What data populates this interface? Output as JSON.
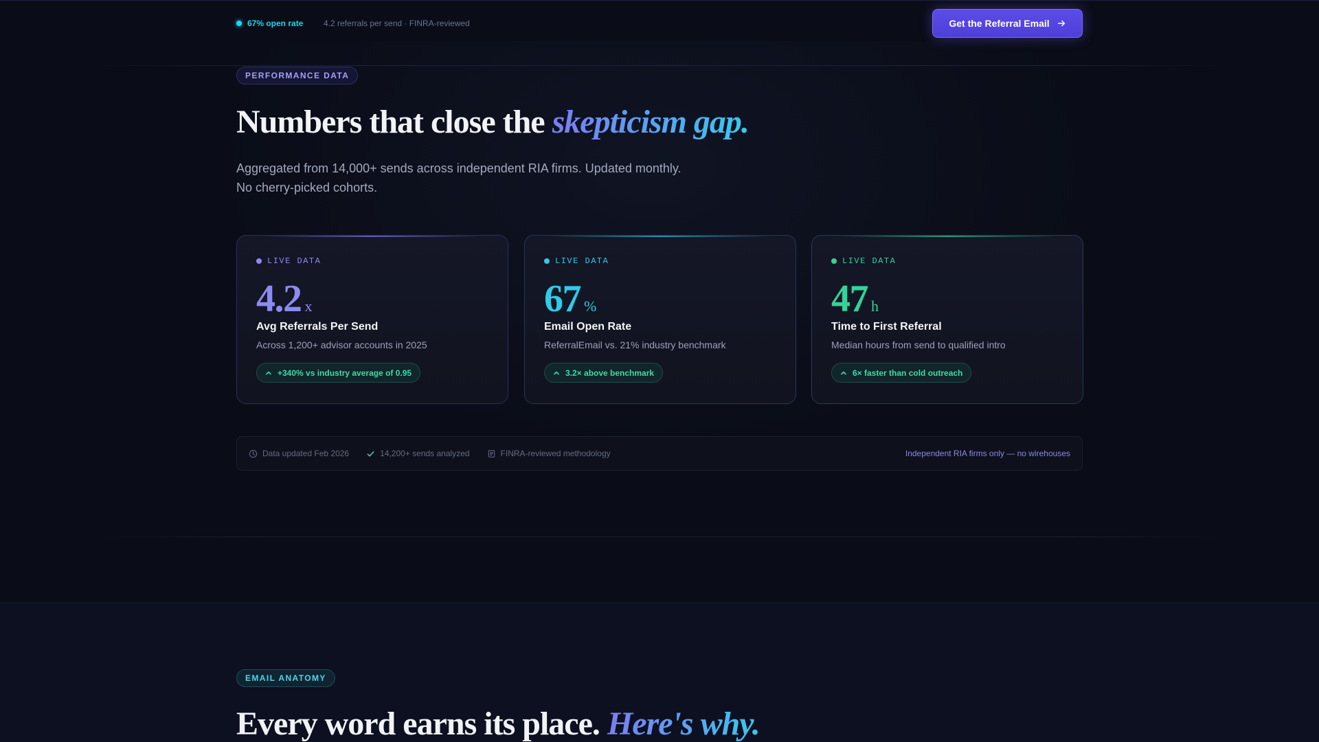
{
  "topbar": {
    "open_rate": "67% open rate",
    "meta": "4.2 referrals per send · FINRA-reviewed",
    "cta_label": "Get the Referral Email"
  },
  "section1": {
    "eyebrow": "PERFORMANCE DATA",
    "headline_plain": "Numbers that close the ",
    "headline_em": "skepticism gap.",
    "subtitle_line1": "Aggregated from 14,000+ sends across independent RIA firms. Updated monthly.",
    "subtitle_line2": "No cherry-picked cohorts."
  },
  "cards": [
    {
      "live": "LIVE DATA",
      "value": "4.2",
      "unit": "x",
      "title": "Avg Referrals Per Send",
      "desc": "Across 1,200+ advisor accounts in 2025",
      "badge": "+340% vs industry average of 0.95",
      "accent": "#8b8bf2"
    },
    {
      "live": "LIVE DATA",
      "value": "67",
      "unit": "%",
      "title": "Email Open Rate",
      "desc": "ReferralEmail vs. 21% industry benchmark",
      "badge": "3.2× above benchmark",
      "accent": "#2fcbe8"
    },
    {
      "live": "LIVE DATA",
      "value": "47",
      "unit": "h",
      "title": "Time to First Referral",
      "desc": "Median hours from send to qualified intro",
      "badge": "6× faster than cold outreach",
      "accent": "#34d399"
    }
  ],
  "footer_bar": {
    "updated": "Data updated Feb 2026",
    "sends": "14,200+ sends analyzed",
    "methodology": "FINRA-reviewed methodology",
    "right": "Independent RIA firms only — no wirehouses"
  },
  "section2": {
    "eyebrow": "EMAIL ANATOMY",
    "headline_plain": "Every word earns its place. ",
    "headline_em": "Here's why."
  },
  "icons": [
    "status-dot",
    "arrow-right-icon",
    "chevron-up-icon",
    "clock-icon",
    "check-icon",
    "document-icon"
  ]
}
